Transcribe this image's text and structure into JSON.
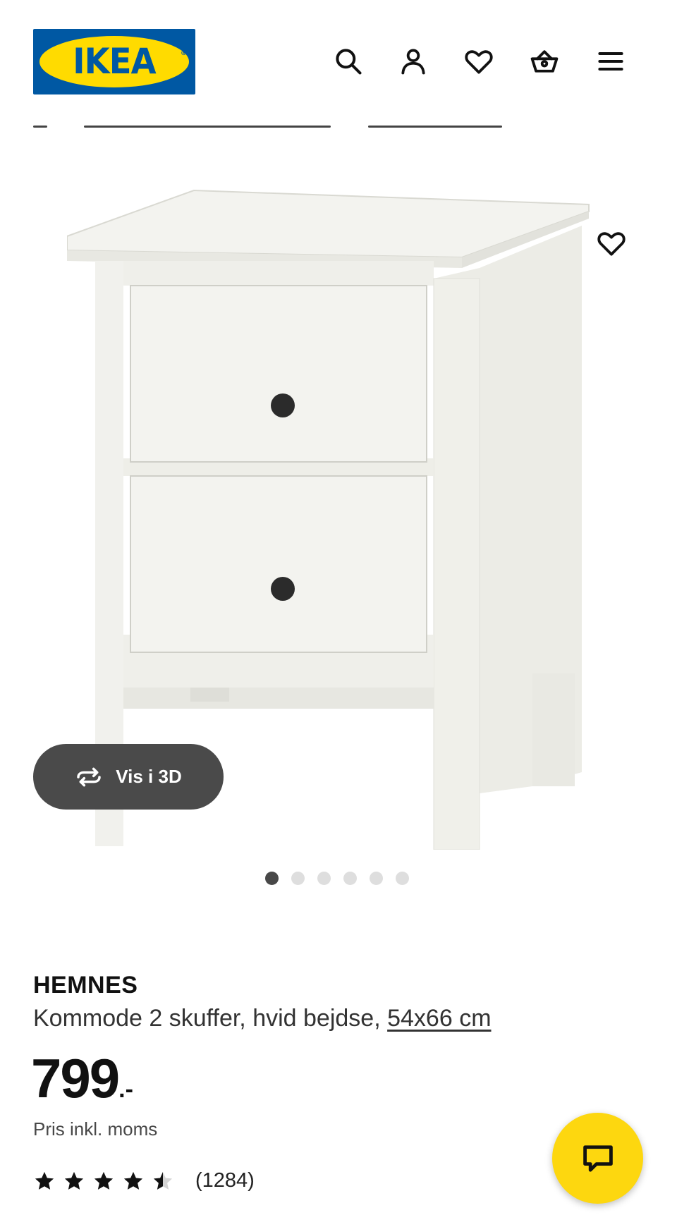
{
  "header": {
    "logo_text": "IKEA",
    "logo_reg": "®",
    "brand_blue": "#0058a3",
    "brand_yellow": "#ffdb00",
    "icons": [
      "search-icon",
      "profile-icon",
      "favourites-icon",
      "basket-icon",
      "menu-icon"
    ]
  },
  "product": {
    "view_3d_label": "Vis i 3D",
    "image_count": 6,
    "active_image": 1,
    "name": "HEMNES",
    "description": "Kommode 2 skuffer, hvid bejdse,",
    "size_link": "54x66 cm",
    "price_main": "799",
    "price_suffix": ".-",
    "price_note": "Pris inkl. moms",
    "rating_value": 4.5,
    "rating_max": 5,
    "review_count": "(1284)"
  },
  "chat": {
    "icon": "chat-icon",
    "color": "#fdd70f"
  }
}
